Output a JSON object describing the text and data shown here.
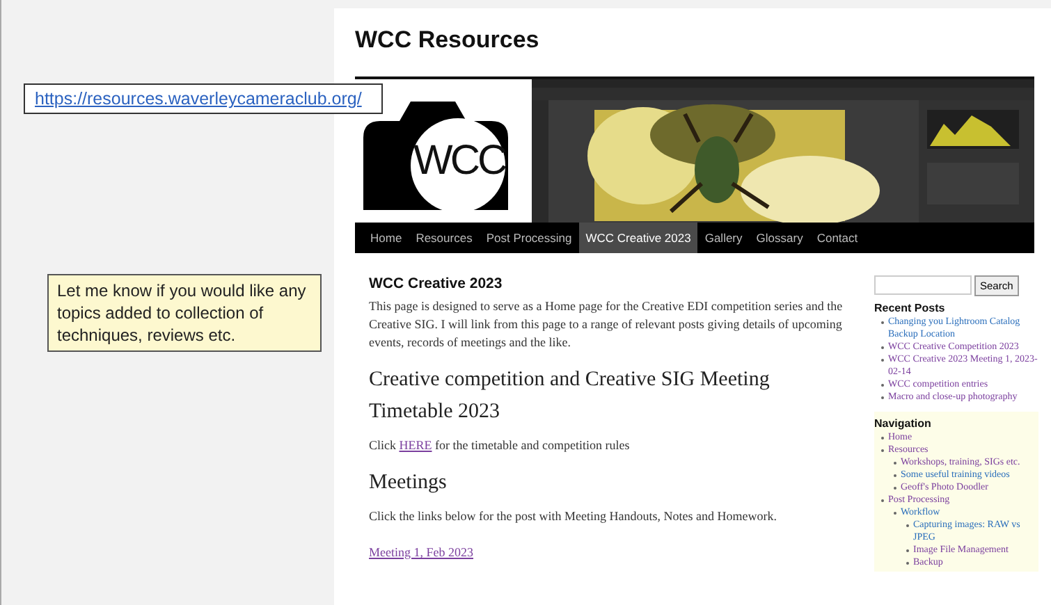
{
  "slide": {
    "url_link": "https://resources.waverleycameraclub.org/",
    "note": "Let me know if you would like any topics added to collection of techniques, reviews etc."
  },
  "site": {
    "title": "WCC Resources",
    "logo_text": "WCC",
    "nav": [
      {
        "label": "Home",
        "selected": false
      },
      {
        "label": "Resources",
        "selected": false
      },
      {
        "label": "Post Processing",
        "selected": false
      },
      {
        "label": "WCC Creative 2023",
        "selected": true
      },
      {
        "label": "Gallery",
        "selected": false
      },
      {
        "label": "Glossary",
        "selected": false
      },
      {
        "label": "Contact",
        "selected": false
      }
    ],
    "main": [
      {
        "kind": "heading",
        "text": "WCC Creative 2023"
      },
      {
        "kind": "paragraph",
        "text": "This page is designed to serve as a Home page for the Creative EDI competition series and the Creative SIG. I will link from this page to a range of relevant posts giving details of upcoming events, records of meetings and the like."
      },
      {
        "kind": "subheading",
        "text": "Creative competition and Creative SIG Meeting Timetable 2023"
      },
      {
        "kind": "link_paragraph",
        "before": "Click",
        "link": "HERE",
        "after": "for the timetable and competition rules"
      },
      {
        "kind": "subheading",
        "text": "Meetings"
      },
      {
        "kind": "paragraph",
        "text": "Click the links below for the post with Meeting Handouts, Notes and Homework."
      },
      {
        "kind": "link",
        "text": "Meeting 1, Feb 2023"
      }
    ],
    "search_button": "Search",
    "recent_posts": {
      "title": "Recent Posts",
      "items": [
        {
          "label": "Changing you Lightroom Catalog Backup Location",
          "visited": false
        },
        {
          "label": "WCC Creative Competition 2023",
          "visited": true
        },
        {
          "label": "WCC Creative 2023 Meeting 1, 2023-02-14",
          "visited": true
        },
        {
          "label": "WCC competition entries",
          "visited": true
        },
        {
          "label": "Macro and close-up photography",
          "visited": true
        }
      ]
    },
    "navigation": {
      "title": "Navigation",
      "items": [
        {
          "label": "Home",
          "visited": true
        },
        {
          "label": "Resources",
          "visited": true,
          "children": [
            {
              "label": "Workshops, training, SIGs etc.",
              "visited": true
            },
            {
              "label": "Some useful training videos",
              "visited": false
            },
            {
              "label": "Geoff's Photo Doodler",
              "visited": true
            }
          ]
        },
        {
          "label": "Post Processing",
          "visited": true,
          "children": [
            {
              "label": "Workflow",
              "visited": false,
              "children": [
                {
                  "label": "Capturing images: RAW vs JPEG",
                  "visited": false
                },
                {
                  "label": "Image File Management",
                  "visited": true
                },
                {
                  "label": "Backup",
                  "visited": true
                }
              ]
            }
          ]
        }
      ]
    }
  }
}
